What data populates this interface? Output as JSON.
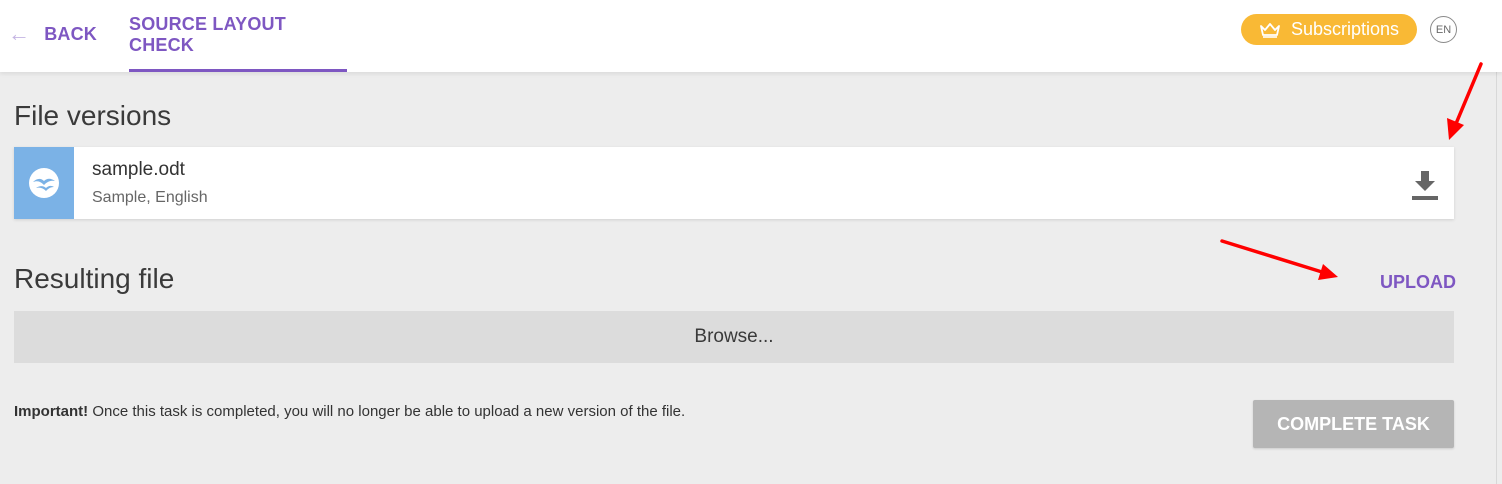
{
  "nav": {
    "back_label": "BACK",
    "tab_label": "SOURCE LAYOUT CHECK",
    "subscriptions_label": "Subscriptions",
    "language": "EN"
  },
  "file_versions": {
    "title": "File versions",
    "file": {
      "name": "sample.odt",
      "meta": "Sample, English",
      "icon": "openoffice-icon"
    }
  },
  "resulting_file": {
    "title": "Resulting file",
    "upload_label": "UPLOAD",
    "browse_label": "Browse..."
  },
  "notice": {
    "strong": "Important!",
    "text": " Once this task is completed, you will no longer be able to upload a new version of the file."
  },
  "complete_label": "COMPLETE TASK",
  "colors": {
    "accent": "#7e57c2",
    "subscriptions": "#f9b935",
    "file_icon_bg": "#7bb2e6",
    "annotation": "#ff0000"
  }
}
